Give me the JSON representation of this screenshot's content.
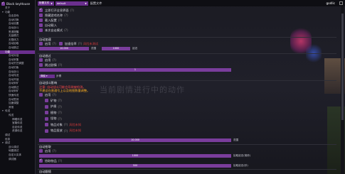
{
  "app": {
    "title": "Black keyHouse"
  },
  "colors": {
    "accent": "#6a2f8e",
    "check": "#7a3d9c",
    "warn": "#d53a3a",
    "note": "#ffb020",
    "panel_bg": "#14141a"
  },
  "sidebar": {
    "items": [
      {
        "label": "关于",
        "level": 1,
        "arrow": "",
        "selected": false
      },
      {
        "label": "功能",
        "level": 1,
        "arrow": "▾",
        "selected": false
      },
      {
        "label": "自走游戏",
        "level": 2,
        "arrow": "",
        "selected": false
      },
      {
        "label": "自动切换",
        "level": 2,
        "arrow": "",
        "selected": false
      },
      {
        "label": "自动设置",
        "level": 2,
        "arrow": "",
        "selected": false
      },
      {
        "label": "自动战斗",
        "level": 2,
        "arrow": "",
        "selected": false
      },
      {
        "label": "签退提醒",
        "level": 2,
        "arrow": "",
        "selected": false
      },
      {
        "label": "无敌模式",
        "level": 2,
        "arrow": "",
        "selected": false
      },
      {
        "label": "无限体力",
        "level": 2,
        "arrow": "",
        "selected": false
      },
      {
        "label": "自动拾取",
        "level": 2,
        "arrow": "",
        "selected": false
      },
      {
        "label": "自动跳过",
        "level": 2,
        "arrow": "",
        "selected": false
      },
      {
        "label": "功能",
        "level": 1,
        "arrow": "",
        "selected": true
      },
      {
        "label": "自动对话",
        "level": 2,
        "arrow": "",
        "selected": false
      },
      {
        "label": "自动采集",
        "level": 2,
        "arrow": "",
        "selected": false
      },
      {
        "label": "自动烹饪调整",
        "level": 2,
        "arrow": "",
        "selected": false
      },
      {
        "label": "自动钓鱼",
        "level": 2,
        "arrow": "",
        "selected": false
      },
      {
        "label": "自动战斗",
        "level": 2,
        "arrow": "",
        "selected": false
      },
      {
        "label": "自动传送",
        "level": 2,
        "arrow": "",
        "selected": false
      },
      {
        "label": "自动开锁",
        "level": 2,
        "arrow": "",
        "selected": false
      },
      {
        "label": "自动采矿",
        "level": 2,
        "arrow": "",
        "selected": false
      },
      {
        "label": "自动跳过",
        "level": 2,
        "arrow": "",
        "selected": false
      },
      {
        "label": "自动采矿",
        "level": 2,
        "arrow": "",
        "selected": false
      },
      {
        "label": "快速传送",
        "level": 2,
        "arrow": "",
        "selected": false
      },
      {
        "label": "自动签到",
        "level": 2,
        "arrow": "",
        "selected": false
      },
      {
        "label": "加速调整",
        "level": 2,
        "arrow": "",
        "selected": false
      },
      {
        "label": "其他",
        "level": 2,
        "arrow": "",
        "selected": false
      },
      {
        "label": "传送",
        "level": 1,
        "arrow": "▾",
        "selected": false
      },
      {
        "label": "传送",
        "level": 2,
        "arrow": "",
        "selected": false
      },
      {
        "label": "神瞳传送",
        "level": 3,
        "arrow": "",
        "selected": false
      },
      {
        "label": "宝箱传送",
        "level": 3,
        "arrow": "",
        "selected": false
      },
      {
        "label": "自定传送",
        "level": 3,
        "arrow": "",
        "selected": false
      },
      {
        "label": "资源传送",
        "level": 3,
        "arrow": "",
        "selected": false
      },
      {
        "label": "调试",
        "level": 1,
        "arrow": "",
        "selected": false
      },
      {
        "label": "信息",
        "level": 1,
        "arrow": "",
        "selected": false
      },
      {
        "label": "调试",
        "level": 1,
        "arrow": "▾",
        "selected": false
      },
      {
        "label": "战斗调试",
        "level": 2,
        "arrow": "",
        "selected": false
      },
      {
        "label": "地图调试",
        "level": 2,
        "arrow": "",
        "selected": false
      },
      {
        "label": "自定义实体",
        "level": 2,
        "arrow": "",
        "selected": false
      },
      {
        "label": "调试器",
        "level": 2,
        "arrow": "",
        "selected": false
      }
    ]
  },
  "topbar": {
    "config_combo": "配置文件",
    "profile_combo": "default",
    "config_label": "配置文件",
    "user": "godlic"
  },
  "main": {
    "toggles_top": [
      {
        "label": "立即打开全息界面",
        "checked": true,
        "help": "(?)"
      },
      {
        "label": "隐藏游戏名称",
        "checked": false,
        "help": "(?)"
      },
      {
        "label": "载入配置",
        "checked": false,
        "help": "(?)"
      },
      {
        "label": "自动载入",
        "checked": false,
        "help": ""
      },
      {
        "label": "本次自走模式",
        "checked": false,
        "help": "(?)"
      }
    ],
    "sect_auto_speed": {
      "title": "自动加速",
      "enabled_label": "启用",
      "enabled_help": "(?)",
      "boost_label": "加速倍率",
      "boost_help": "(?)",
      "boost_warn": "风险未测试",
      "min_value": "10.000",
      "min_label": "范围",
      "max_value": "1000",
      "max_label": "延迟"
    },
    "sect_auto_escape": {
      "title": "自动逃过",
      "enabled_label": "启用",
      "enabled_help": "(?)",
      "item2_label": "跳过剧情",
      "item2_help": "(?)",
      "slider_value": "1"
    },
    "switch": {
      "combo": "弹窗",
      "label": "步骤"
    },
    "sect_auto_battle": {
      "title": "自动战斗影响",
      "note1": "注意: 自动战斗可能会导致被检测。",
      "note2": "不建议在普通号上以及地图数量调整。",
      "enabled_label": "启用",
      "enabled_help": "(?)",
      "items": [
        {
          "label": "矿物",
          "help": "(?)",
          "tag": ""
        },
        {
          "label": "护盾",
          "help": "(?)",
          "tag": ""
        },
        {
          "label": "植物",
          "help": "(?)",
          "tag": ""
        },
        {
          "label": "怪物",
          "help": "(?)",
          "tag": ""
        },
        {
          "label": "物品对象",
          "help": "(?)",
          "tag": "风险未知"
        },
        {
          "label": "物品投放",
          "help": "(?)",
          "tag": "风险未知"
        }
      ],
      "range_value": "10.000",
      "range_label": "范围"
    },
    "sect_auto_loot": {
      "title": "自动拾取",
      "enabled_label": "启用",
      "enabled_help": "(?)",
      "slider1_value": "1000",
      "slider1_label": "拾取延迟(毫秒)",
      "pickup_label": "拾取物品",
      "pickup_help": "(?)",
      "slider2_value": "500",
      "slider2_label": "拾取延迟(秒)"
    },
    "sect_auto_follow": {
      "title": "自动跟随"
    },
    "watermark": "当前剧情进行中的动作"
  }
}
